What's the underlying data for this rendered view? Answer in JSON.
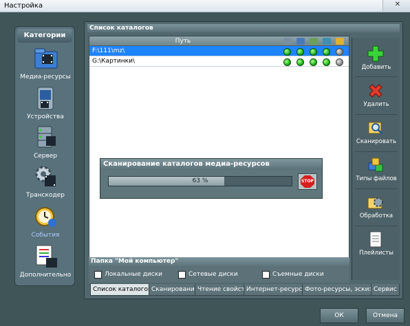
{
  "window": {
    "title": "Настройка",
    "close_glyph": "✕"
  },
  "sidebar": {
    "header": "Категории",
    "items": [
      {
        "label": "Медиа-ресурсы",
        "icon": "media-folder-icon"
      },
      {
        "label": "Устройства",
        "icon": "device-icon"
      },
      {
        "label": "Сервер",
        "icon": "server-icon"
      },
      {
        "label": "Транскодер",
        "icon": "transcoder-gear-icon"
      },
      {
        "label": "События",
        "icon": "events-clock-icon"
      },
      {
        "label": "Дополнительно",
        "icon": "extras-doc-icon"
      }
    ]
  },
  "main": {
    "section_title": "Список каталогов",
    "list": {
      "column_path": "Путь",
      "rows": [
        {
          "path": "F:\\111\\mz\\",
          "flags": [
            "green",
            "green",
            "green",
            "green",
            "grey"
          ]
        },
        {
          "path": "G:\\Картинки\\",
          "flags": [
            "green",
            "green",
            "green",
            "green",
            "grey"
          ]
        }
      ]
    },
    "scan": {
      "title": "Сканирование каталогов медиа-ресурсов",
      "progress_text": "63 %",
      "progress": 0.63,
      "stop_label": "STOP"
    },
    "folder": {
      "title": "Папка \"Мой компьютер\"",
      "options": [
        "Локальные диски",
        "Сетевые диски",
        "Съемные диски"
      ]
    },
    "toolbar": [
      "Добавить",
      "Удалить",
      "Сканировать",
      "Типы файлов",
      "Обработка",
      "Плейлисты"
    ],
    "tabs": [
      "Список каталогов",
      "Сканирование",
      "Чтение свойств",
      "Интернет-ресурсы",
      "Фото-ресурсы, эскизы",
      "Сервис"
    ]
  },
  "buttons": {
    "ok": "ОК",
    "cancel": "Отмена"
  },
  "colors": {
    "selection": "#1e84ff",
    "panel": "#51686e",
    "status_green": "#1fb51a"
  }
}
